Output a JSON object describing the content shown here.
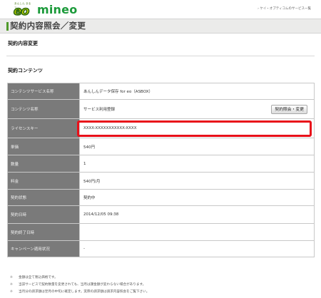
{
  "header": {
    "logo_small": "あんしん まる ッ",
    "logo_mark": "eo",
    "brand": "mineo",
    "link": "› ケイ・オプティコムのサービス一覧"
  },
  "page": {
    "title": "契約内容照会／変更",
    "subtitle": "契約内容変更",
    "section_title": "契約コンテンツ"
  },
  "contract": {
    "rows": [
      {
        "label": "コンテンツサービス名称",
        "value": "あんしんデータ保存 for eo（ASBOX）"
      },
      {
        "label": "コンテンツ名称",
        "value": "サービス利用登録"
      },
      {
        "label": "ライセンスキー",
        "value": "XXXX-XXXXXXXXXXX-XXXX"
      },
      {
        "label": "単価",
        "value": "540円"
      },
      {
        "label": "数量",
        "value": "1"
      },
      {
        "label": "料金",
        "value": "540円/月"
      },
      {
        "label": "契約状態",
        "value": "契約中"
      },
      {
        "label": "契約日時",
        "value": "2014/12/05 09:38"
      },
      {
        "label": "契約終了日時",
        "value": ""
      },
      {
        "label": "キャンペーン適用状況",
        "value": "-"
      }
    ],
    "button_label": "契約照会・変更"
  },
  "notes": [
    {
      "mark": "※",
      "text": "金額は全て税込価格です。"
    },
    {
      "mark": "※",
      "text": "当該サービスで契約数量を変更されても、当月は課金額が変わらない場合があります。"
    },
    {
      "mark": "※",
      "text": "当月分の請求額は翌月の中旬に確定します。実際の請求額は請求内容照会をご覧下さい。"
    }
  ],
  "colors": {
    "brand_green": "#1b9a3a",
    "highlight": "#e8101a",
    "label_bg": "#7a7a7a"
  }
}
